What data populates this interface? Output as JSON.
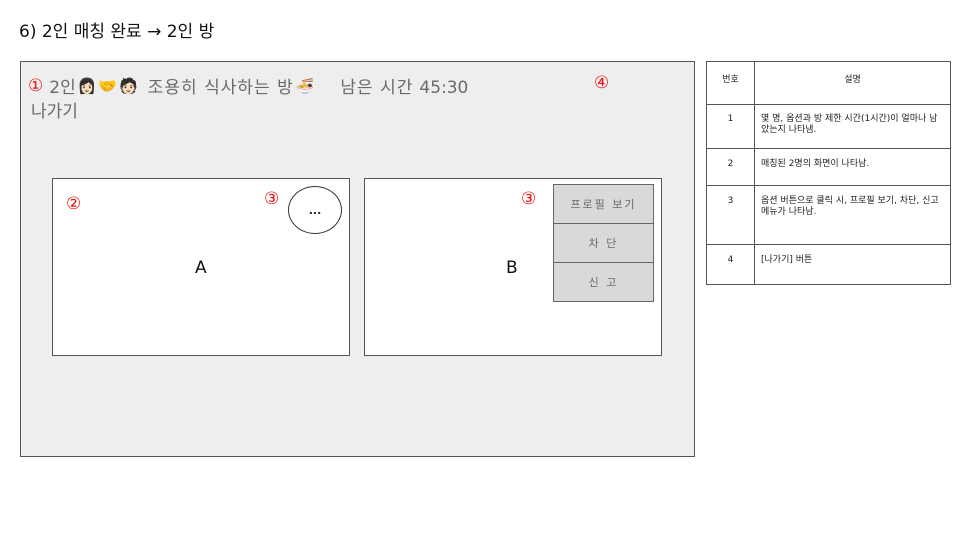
{
  "page_title": "6) 2인 매칭 완료 → 2인 방",
  "markers": {
    "m1": "①",
    "m2": "②",
    "m3": "③",
    "m4": "④"
  },
  "room": {
    "member_count": "2인",
    "emojis": [
      "👩🏻",
      "🤝",
      "🧑🏻"
    ],
    "name": "조용히 식사하는 방",
    "name_emoji": "🍜",
    "timer_label": "남은 시간",
    "timer_value": "45:30",
    "leave_label": "나가기"
  },
  "screens": {
    "a_label": "A",
    "b_label": "B",
    "options_label": "...",
    "menu": [
      "프로필 보기",
      "차 단",
      "신 고"
    ]
  },
  "legend": {
    "headers": [
      "번호",
      "설명"
    ],
    "rows": [
      {
        "num": "1",
        "desc": "몇 명, 옵션과 방 제한 시간(1시간)이 얼마나 남았는지 나타냄."
      },
      {
        "num": "2",
        "desc": "매칭된 2명의 화면이 나타남."
      },
      {
        "num": "3",
        "desc": "옵션 버튼으로 클릭 시, 프로필 보기, 차단, 신고 메뉴가 나타남."
      },
      {
        "num": "4",
        "desc": "[나가기] 버튼"
      }
    ]
  },
  "colors": {
    "marker": "#e11111",
    "room_bg": "#eeeeee",
    "menu_bg": "#d9d9d9"
  }
}
